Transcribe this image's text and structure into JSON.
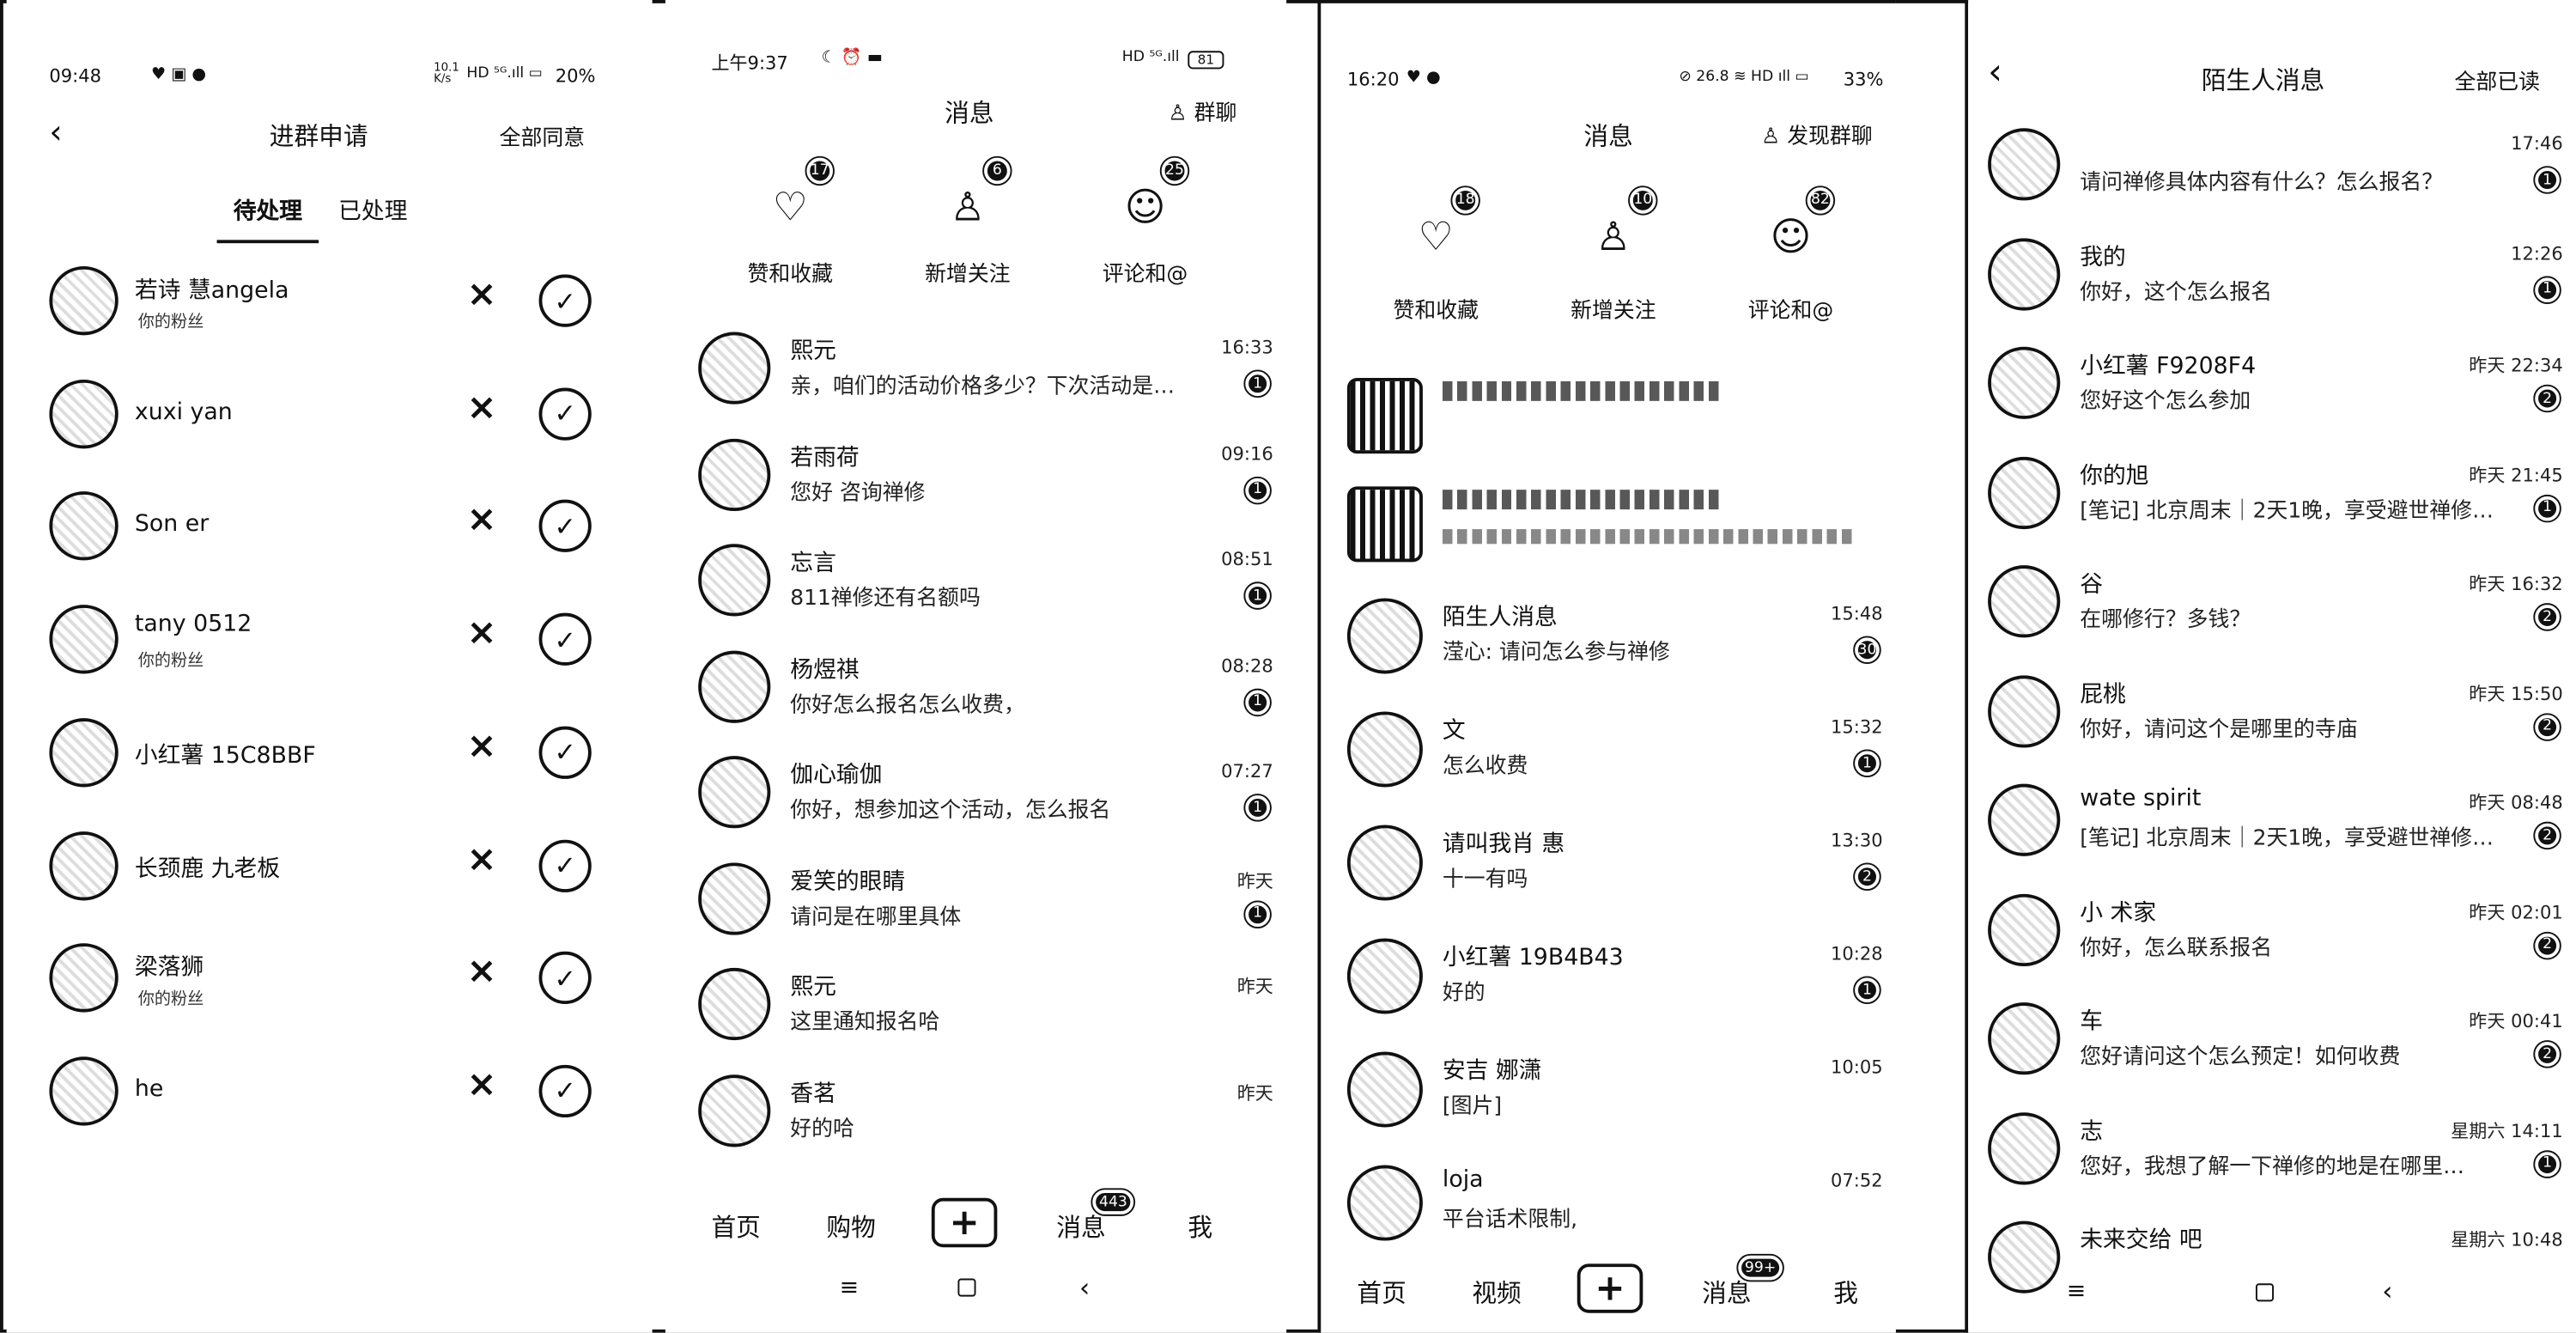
{
  "panel1": {
    "status_time": "09:48",
    "status_right": "20%",
    "status_net": "10.1\nK/s",
    "title": "进群申请",
    "action": "全部同意",
    "tabs": [
      "待处理",
      "已处理"
    ],
    "rows": [
      {
        "name": "若诗 慧angela",
        "sub": "你的粉丝"
      },
      {
        "name": "xuxi  yan",
        "sub": ""
      },
      {
        "name": "Son er",
        "sub": ""
      },
      {
        "name": "tany 0512",
        "sub": "你的粉丝"
      },
      {
        "name": "小红薯 15C8BBF",
        "sub": ""
      },
      {
        "name": "长颈鹿 九老板",
        "sub": ""
      },
      {
        "name": "梁落狮",
        "sub": "你的粉丝"
      },
      {
        "name": "he",
        "sub": ""
      }
    ]
  },
  "panel2": {
    "status_time": "上午9:37",
    "status_right": "81",
    "title": "消息",
    "action": "群聊",
    "categories": [
      {
        "label": "赞和收藏",
        "badge": "17"
      },
      {
        "label": "新增关注",
        "badge": "6"
      },
      {
        "label": "评论和@",
        "badge": "25"
      }
    ],
    "messages": [
      {
        "name": "熙元",
        "preview": "亲，咱们的活动价格多少？下次活动是…",
        "time": "16:33",
        "badge": "1"
      },
      {
        "name": "若雨荷",
        "preview": "您好 咨询禅修",
        "time": "09:16",
        "badge": "1"
      },
      {
        "name": "忘言",
        "preview": "811禅修还有名额吗",
        "time": "08:51",
        "badge": "1"
      },
      {
        "name": "杨煜祺",
        "preview": "你好怎么报名怎么收费，",
        "time": "08:28",
        "badge": "1"
      },
      {
        "name": "伽心瑜伽",
        "preview": "你好，想参加这个活动，怎么报名",
        "time": "07:27",
        "badge": "1"
      },
      {
        "name": "爱笑的眼睛",
        "preview": "请问是在哪里具体",
        "time": "昨天",
        "badge": "1"
      },
      {
        "name": "熙元",
        "preview": "这里通知报名哈",
        "time": "昨天",
        "badge": ""
      },
      {
        "name": "香茗",
        "preview": "好的哈",
        "time": "昨天",
        "badge": ""
      }
    ],
    "nav": [
      "首页",
      "购物",
      "消息",
      "我"
    ],
    "nav_badge": "443"
  },
  "panel3": {
    "status_time": "16:20",
    "status_right": "33%",
    "status_net": "26.8\nK/s",
    "title": "消息",
    "action": "发现群聊",
    "categories": [
      {
        "label": "赞和收藏",
        "badge": "18"
      },
      {
        "label": "新增关注",
        "badge": "10"
      },
      {
        "label": "评论和@",
        "badge": "82"
      }
    ],
    "messages": [
      {
        "name": "陌生人消息",
        "preview": "滢心: 请问怎么参与禅修",
        "time": "15:48",
        "badge": "30"
      },
      {
        "name": "文",
        "preview": "怎么收费",
        "time": "15:32",
        "badge": "1"
      },
      {
        "name": "请叫我肖 惠",
        "preview": "十一有吗",
        "time": "13:30",
        "badge": "2"
      },
      {
        "name": "小红薯 19B4B43",
        "preview": "好的",
        "time": "10:28",
        "badge": "1"
      },
      {
        "name": "安吉 娜潇",
        "preview": "[图片]",
        "time": "10:05",
        "badge": ""
      },
      {
        "name": "loja",
        "preview": "平台话术限制,",
        "time": "07:52",
        "badge": ""
      }
    ],
    "nav": [
      "首页",
      "视频",
      "消息",
      "我"
    ],
    "nav_badge": "99+"
  },
  "panel4": {
    "title": "陌生人消息",
    "action": "全部已读",
    "messages": [
      {
        "name": "",
        "preview": "请问禅修具体内容有什么？怎么报名？",
        "time": "17:46",
        "badge": "1"
      },
      {
        "name": "我的",
        "preview": "你好，这个怎么报名",
        "time": "12:26",
        "badge": "1"
      },
      {
        "name": "小红薯 F9208F4",
        "preview": "您好这个怎么参加",
        "time": "昨天 22:34",
        "badge": "2"
      },
      {
        "name": "你的旭",
        "preview": "[笔记] 北京周末｜2天1晚，享受避世禅修…",
        "time": "昨天 21:45",
        "badge": "1"
      },
      {
        "name": "谷",
        "preview": "在哪修行？多钱？",
        "time": "昨天 16:32",
        "badge": "2"
      },
      {
        "name": "屁桃",
        "preview": "你好，请问这个是哪里的寺庙",
        "time": "昨天 15:50",
        "badge": "2"
      },
      {
        "name": "wate  spirit",
        "preview": "[笔记] 北京周末｜2天1晚，享受避世禅修…",
        "time": "昨天 08:48",
        "badge": "2"
      },
      {
        "name": "小 术家",
        "preview": "你好，怎么联系报名",
        "time": "昨天 02:01",
        "badge": "2"
      },
      {
        "name": "车",
        "preview": "您好请问这个怎么预定！如何收费",
        "time": "昨天 00:41",
        "badge": "2"
      },
      {
        "name": "志",
        "preview": "您好，我想了解一下禅修的地是在哪里…",
        "time": "星期六 14:11",
        "badge": "1"
      },
      {
        "name": "未来交给 吧",
        "preview": "",
        "time": "星期六 10:48",
        "badge": ""
      }
    ]
  }
}
